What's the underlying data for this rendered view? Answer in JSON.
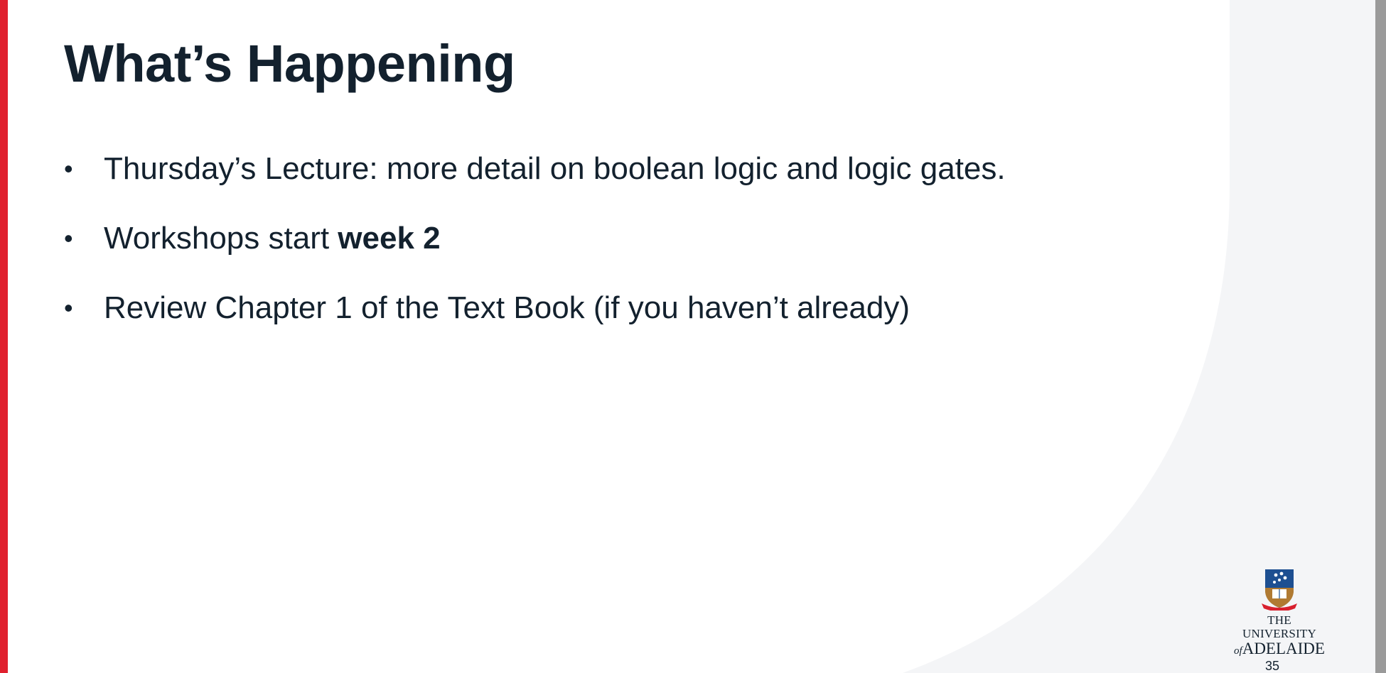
{
  "slide": {
    "title": "What’s Happening",
    "bullets": [
      {
        "text": "Thursday’s Lecture: more detail on boolean logic and logic gates.",
        "bold_suffix": ""
      },
      {
        "text": "Workshops start ",
        "bold_suffix": "week 2"
      },
      {
        "text": "Review Chapter 1 of the Text Book (if you haven’t already)",
        "bold_suffix": ""
      }
    ],
    "bullet_glyph": "•",
    "page_number": "35"
  },
  "logo": {
    "line1": "THE UNIVERSITY",
    "line2_prefix": "of",
    "line2": "ADELAIDE",
    "icon": "university-crest-icon"
  },
  "colors": {
    "accent_bar": "#e0202e",
    "text": "#13212e",
    "background_shape": "#f4f5f7",
    "scrollbar": "#9a9a9a"
  }
}
